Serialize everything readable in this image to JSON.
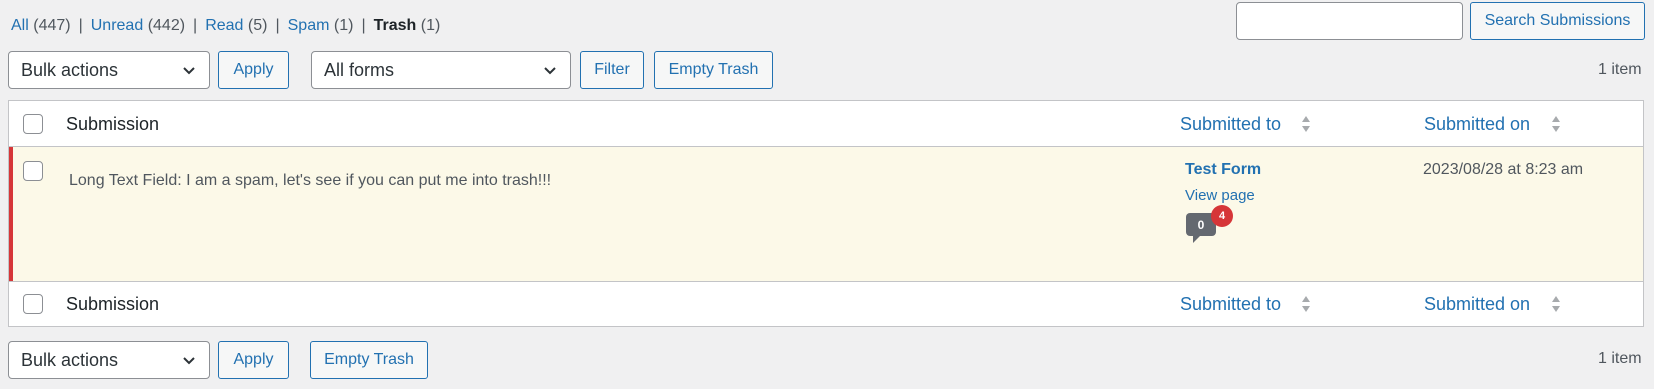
{
  "status_filters": [
    {
      "label": "All",
      "count": "(447)",
      "current": false
    },
    {
      "label": "Unread",
      "count": "(442)",
      "current": false
    },
    {
      "label": "Read",
      "count": "(5)",
      "current": false
    },
    {
      "label": "Spam",
      "count": "(1)",
      "current": false
    },
    {
      "label": "Trash",
      "count": "(1)",
      "current": true
    }
  ],
  "separator": "|",
  "search": {
    "value": "",
    "placeholder": "",
    "button_label": "Search Submissions"
  },
  "top_nav": {
    "bulk_actions_selected": "Bulk actions",
    "apply_label": "Apply",
    "forms_selected": "All forms",
    "filter_label": "Filter",
    "empty_trash_label": "Empty Trash",
    "displaying_num": "1 item"
  },
  "table": {
    "columns": {
      "submission": "Submission",
      "submitted_to": "Submitted to",
      "submitted_on": "Submitted on"
    },
    "rows": [
      {
        "text": "Long Text Field: I am a spam, let's see if you can put me into trash!!!",
        "form_title": "Test Form",
        "view_link": "View page",
        "comment_count": "0",
        "pending_count": "4",
        "date": "2023/08/28 at 8:23 am"
      }
    ]
  },
  "bottom_nav": {
    "bulk_actions_selected": "Bulk actions",
    "apply_label": "Apply",
    "empty_trash_label": "Empty Trash",
    "displaying_num": "1 item"
  },
  "colors": {
    "link": "#2271b1",
    "trash_row_bg": "#fcf9e8",
    "trash_row_border": "#d63638",
    "badge": "#d63638"
  }
}
